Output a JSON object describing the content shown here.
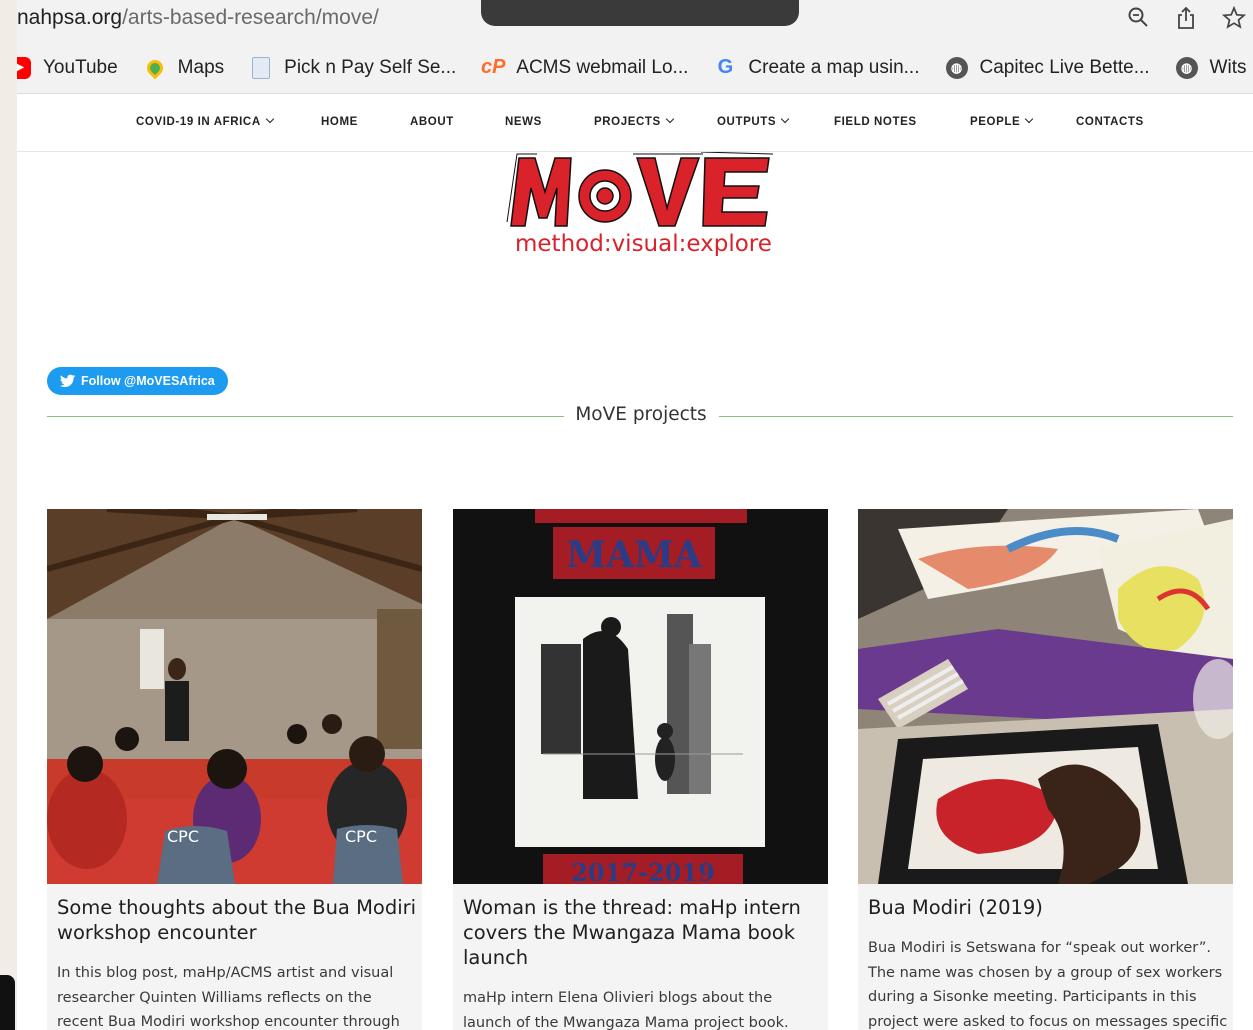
{
  "browser": {
    "url_domain": "nahpsa.org",
    "url_path": "/arts-based-research/move/",
    "icons": [
      "zoom-icon",
      "share-icon",
      "bookmark-star-icon"
    ]
  },
  "bookmarks": [
    {
      "label": "YouTube",
      "icon": "youtube-icon"
    },
    {
      "label": "Maps",
      "icon": "maps-icon"
    },
    {
      "label": "Pick n Pay Self Se...",
      "icon": "document-icon"
    },
    {
      "label": "ACMS webmail Lo...",
      "icon": "cpanel-icon"
    },
    {
      "label": "Create a map usin...",
      "icon": "google-icon"
    },
    {
      "label": "Capitec Live Bette...",
      "icon": "globe-icon"
    },
    {
      "label": "Wits",
      "icon": "globe-icon"
    }
  ],
  "nav": {
    "covid": "COVID-19 IN AFRICA",
    "home": "HOME",
    "about": "ABOUT",
    "news": "NEWS",
    "projects": "PROJECTS",
    "outputs": "OUTPUTS",
    "field_notes": "FIELD NOTES",
    "people": "PEOPLE",
    "contacts": "CONTACTS"
  },
  "logo": {
    "wordmark": "MoVE",
    "tagline": "method:visual:explore"
  },
  "twitter": {
    "follow_label": "Follow @MoVESAfrica"
  },
  "section": {
    "title": "MoVE projects"
  },
  "cards": [
    {
      "title": "Some thoughts about the Bua Modiri workshop encounter",
      "excerpt": "In this blog post, maHp/ACMS artist and visual researcher Quinten Williams reflects on the recent Bua Modiri workshop encounter through the",
      "image_text": "CPC"
    },
    {
      "title": "Woman is the thread: maHp intern covers the Mwangaza Mama book launch",
      "excerpt": "maHp intern Elena Olivieri blogs about the launch of the Mwangaza Mama project book.",
      "image_text_top": "MAMA",
      "image_text_bottom": "2017-2019"
    },
    {
      "title": "Bua Modiri (2019)",
      "excerpt": "Bua Modiri is Setswana for “speak out worker”. The name was chosen by a group of sex workers during a Sisonke meeting. Participants in this project were asked to focus on messages specific"
    }
  ],
  "colors": {
    "brand_red": "#d9222a",
    "twitter_blue": "#1d9bf0",
    "section_rule": "#8bbf7a"
  }
}
